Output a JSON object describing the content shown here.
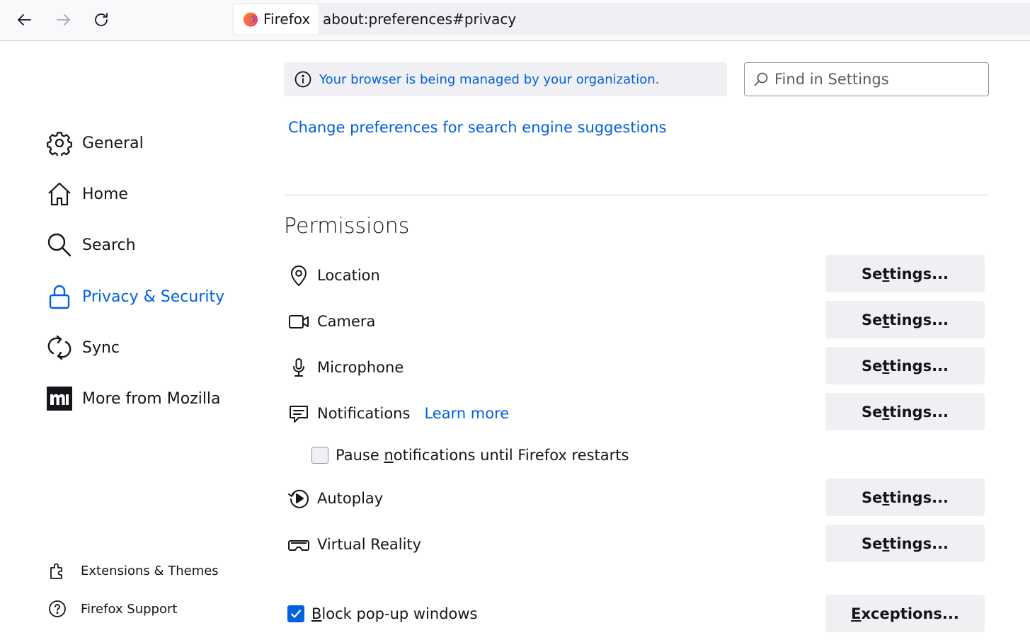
{
  "toolbar": {
    "identity_label": "Firefox",
    "url": "about:preferences#privacy"
  },
  "sidebar": {
    "categories": [
      {
        "label": "General",
        "icon": "gear-icon"
      },
      {
        "label": "Home",
        "icon": "home-icon"
      },
      {
        "label": "Search",
        "icon": "search-icon"
      },
      {
        "label": "Privacy & Security",
        "icon": "lock-icon",
        "selected": true
      },
      {
        "label": "Sync",
        "icon": "sync-icon"
      },
      {
        "label": "More from Mozilla",
        "icon": "mozilla-icon"
      }
    ],
    "footer": [
      {
        "label": "Extensions & Themes",
        "icon": "puzzle-icon"
      },
      {
        "label": "Firefox Support",
        "icon": "help-icon"
      }
    ]
  },
  "main": {
    "policies_notice": "Your browser is being managed by your organization.",
    "search_placeholder": "Find in Settings",
    "search_suggestions_link": "Change preferences for search engine suggestions",
    "permissions": {
      "title": "Permissions",
      "settings_label": "Settings...",
      "rows": [
        {
          "label": "Location",
          "icon": "location-icon"
        },
        {
          "label": "Camera",
          "icon": "camera-icon"
        },
        {
          "label": "Microphone",
          "icon": "microphone-icon"
        },
        {
          "label": "Notifications",
          "icon": "notifications-icon",
          "link": "Learn more"
        },
        {
          "label": "Autoplay",
          "icon": "autoplay-icon"
        },
        {
          "label": "Virtual Reality",
          "icon": "vr-icon"
        }
      ],
      "pause_notifications": {
        "label": "Pause notifications until Firefox restarts",
        "checked": false
      },
      "block_popups": {
        "label": "Block pop-up windows",
        "checked": true
      },
      "exceptions_label": "Exceptions..."
    }
  },
  "colors": {
    "accent": "#0061e0",
    "button_bg": "#f0f0f4",
    "text": "#15141a"
  }
}
